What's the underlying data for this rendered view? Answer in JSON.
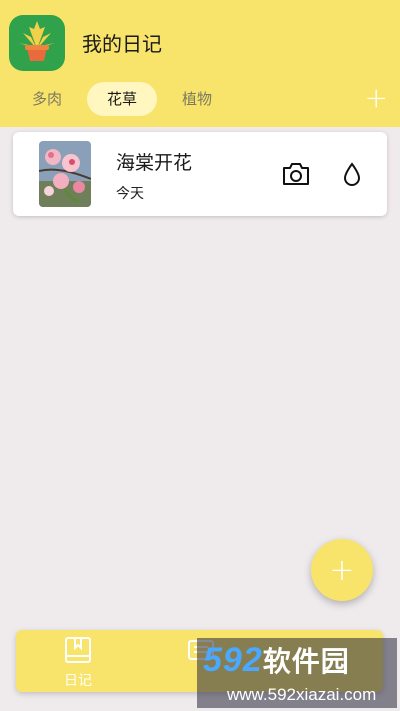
{
  "app": {
    "title": "我的日记",
    "icon": "potted-plant-logo"
  },
  "tabs": [
    {
      "label": "多肉",
      "active": false
    },
    {
      "label": "花草",
      "active": true
    },
    {
      "label": "植物",
      "active": false
    }
  ],
  "tab_add_label": "+",
  "entries": [
    {
      "title": "海棠开花",
      "date": "今天",
      "thumbnail": "crabapple-blossom-photo",
      "actions": [
        "camera-icon",
        "water-drop-icon"
      ]
    }
  ],
  "fab_label": "+",
  "bottom_nav": [
    {
      "label": "日记",
      "icon": "book-icon"
    },
    {
      "label": "",
      "icon": "list-icon"
    }
  ],
  "watermark": {
    "brand_num": "592",
    "brand_cn": "软件园",
    "url": "www.592xiazai.com"
  },
  "colors": {
    "accent": "#F8E46B",
    "background": "#EFEAEC",
    "card": "#FFFFFF",
    "active_tab": "#FFF6C0"
  }
}
